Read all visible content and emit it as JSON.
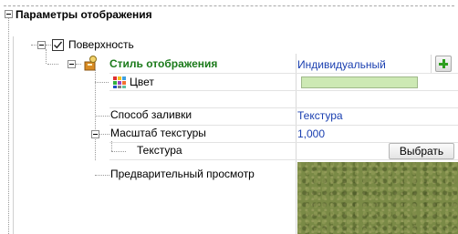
{
  "section": {
    "title": "Параметры отображения"
  },
  "surface": {
    "label": "Поверхность",
    "checked": true
  },
  "style_row": {
    "label": "Стиль отображения",
    "value": "Индивидуальный",
    "add_icon": "plus-icon"
  },
  "color_row": {
    "label": "Цвет",
    "icon": "color-palette-icon",
    "swatch_color": "#cde9b4"
  },
  "fill_row": {
    "label": "Способ заливки",
    "value": "Текстура"
  },
  "scale_row": {
    "label": "Масштаб текстуры",
    "value": "1,000"
  },
  "texture_row": {
    "label": "Текстура",
    "button_label": "Выбрать"
  },
  "preview_row": {
    "label": "Предварительный просмотр"
  },
  "colors": {
    "header_bg": "#ffffff",
    "value_blue": "#1a3fb0",
    "highlight_bg": "#fbfbf2",
    "green": "#2d9e1f"
  }
}
